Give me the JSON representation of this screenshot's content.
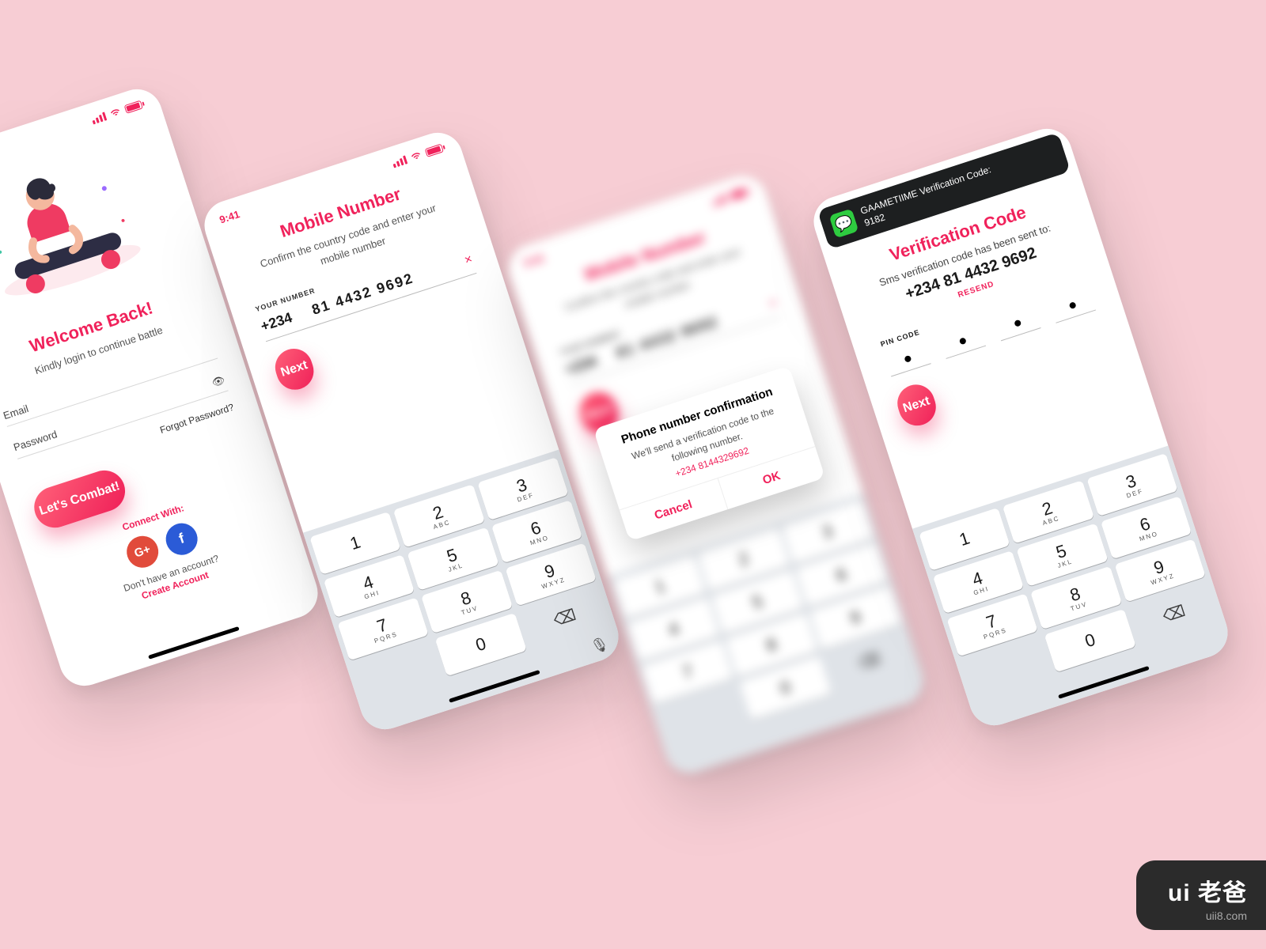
{
  "meta": {
    "time": "9:41"
  },
  "screen1": {
    "title": "Welcome Back!",
    "subtitle": "Kindly login to continue battle",
    "email_label": "Email",
    "password_label": "Password",
    "forgot": "Forgot Password?",
    "cta": "Let's Combat!",
    "connect": "Connect With:",
    "google": "G+",
    "facebook": "f",
    "no_account": "Don't have an account?",
    "create": "Create Account"
  },
  "screen2": {
    "title": "Mobile Number",
    "subtitle": "Confirm the country code and enter your mobile number",
    "your_number_label": "YOUR NUMBER",
    "country_code": "+234",
    "phone_number": "81  4432  9692",
    "clear": "×",
    "cta": "Next"
  },
  "keypad": {
    "keys": [
      {
        "d": "1",
        "l": ""
      },
      {
        "d": "2",
        "l": "ABC"
      },
      {
        "d": "3",
        "l": "DEF"
      },
      {
        "d": "4",
        "l": "GHI"
      },
      {
        "d": "5",
        "l": "JKL"
      },
      {
        "d": "6",
        "l": "MNO"
      },
      {
        "d": "7",
        "l": "PQRS"
      },
      {
        "d": "8",
        "l": "TUV"
      },
      {
        "d": "9",
        "l": "WXYZ"
      },
      {
        "d": "✳︎",
        "l": ""
      },
      {
        "d": "0",
        "l": ""
      },
      {
        "d": "⌫",
        "l": ""
      }
    ],
    "mic": "🎤"
  },
  "screen3": {
    "dialog_title": "Phone number confirmation",
    "dialog_msg": "We'll send a verification code to the following number.",
    "dialog_phone": "+234 8144329692",
    "cancel": "Cancel",
    "ok": "OK"
  },
  "screen4": {
    "notif_title": "GAAMETIIME Verification Code:",
    "notif_code": "9182",
    "title": "Verification Code",
    "sent": "Sms verification code has been sent to:",
    "phone": "+234 81 4432 9692",
    "resend": "RESEND",
    "pin_label": "PIN CODE",
    "cta": "Next"
  },
  "watermark": {
    "brand": "ui 老爸",
    "url": "uii8.com"
  }
}
